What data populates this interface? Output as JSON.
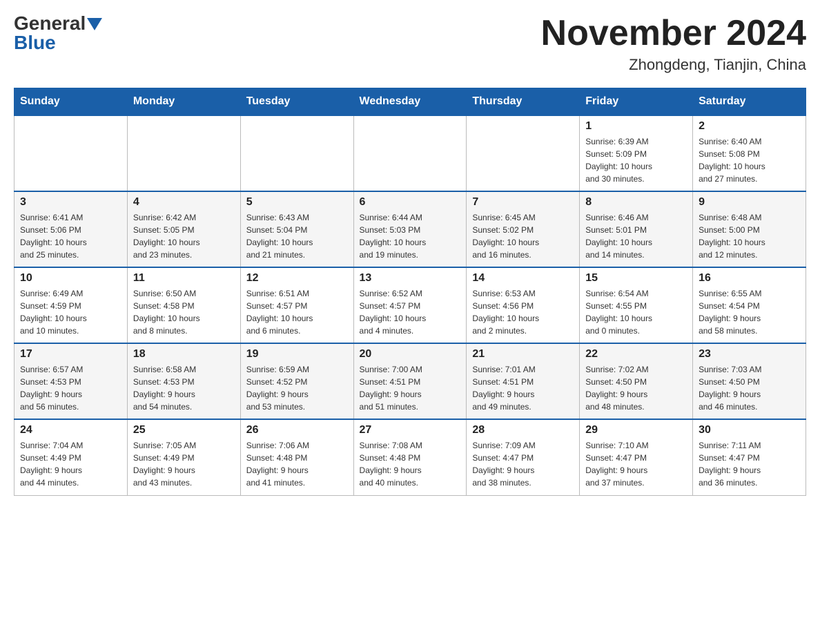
{
  "header": {
    "logo": {
      "general": "General",
      "blue": "Blue"
    },
    "title": "November 2024",
    "location": "Zhongdeng, Tianjin, China"
  },
  "weekdays": [
    "Sunday",
    "Monday",
    "Tuesday",
    "Wednesday",
    "Thursday",
    "Friday",
    "Saturday"
  ],
  "weeks": [
    [
      {
        "day": "",
        "info": ""
      },
      {
        "day": "",
        "info": ""
      },
      {
        "day": "",
        "info": ""
      },
      {
        "day": "",
        "info": ""
      },
      {
        "day": "",
        "info": ""
      },
      {
        "day": "1",
        "info": "Sunrise: 6:39 AM\nSunset: 5:09 PM\nDaylight: 10 hours\nand 30 minutes."
      },
      {
        "day": "2",
        "info": "Sunrise: 6:40 AM\nSunset: 5:08 PM\nDaylight: 10 hours\nand 27 minutes."
      }
    ],
    [
      {
        "day": "3",
        "info": "Sunrise: 6:41 AM\nSunset: 5:06 PM\nDaylight: 10 hours\nand 25 minutes."
      },
      {
        "day": "4",
        "info": "Sunrise: 6:42 AM\nSunset: 5:05 PM\nDaylight: 10 hours\nand 23 minutes."
      },
      {
        "day": "5",
        "info": "Sunrise: 6:43 AM\nSunset: 5:04 PM\nDaylight: 10 hours\nand 21 minutes."
      },
      {
        "day": "6",
        "info": "Sunrise: 6:44 AM\nSunset: 5:03 PM\nDaylight: 10 hours\nand 19 minutes."
      },
      {
        "day": "7",
        "info": "Sunrise: 6:45 AM\nSunset: 5:02 PM\nDaylight: 10 hours\nand 16 minutes."
      },
      {
        "day": "8",
        "info": "Sunrise: 6:46 AM\nSunset: 5:01 PM\nDaylight: 10 hours\nand 14 minutes."
      },
      {
        "day": "9",
        "info": "Sunrise: 6:48 AM\nSunset: 5:00 PM\nDaylight: 10 hours\nand 12 minutes."
      }
    ],
    [
      {
        "day": "10",
        "info": "Sunrise: 6:49 AM\nSunset: 4:59 PM\nDaylight: 10 hours\nand 10 minutes."
      },
      {
        "day": "11",
        "info": "Sunrise: 6:50 AM\nSunset: 4:58 PM\nDaylight: 10 hours\nand 8 minutes."
      },
      {
        "day": "12",
        "info": "Sunrise: 6:51 AM\nSunset: 4:57 PM\nDaylight: 10 hours\nand 6 minutes."
      },
      {
        "day": "13",
        "info": "Sunrise: 6:52 AM\nSunset: 4:57 PM\nDaylight: 10 hours\nand 4 minutes."
      },
      {
        "day": "14",
        "info": "Sunrise: 6:53 AM\nSunset: 4:56 PM\nDaylight: 10 hours\nand 2 minutes."
      },
      {
        "day": "15",
        "info": "Sunrise: 6:54 AM\nSunset: 4:55 PM\nDaylight: 10 hours\nand 0 minutes."
      },
      {
        "day": "16",
        "info": "Sunrise: 6:55 AM\nSunset: 4:54 PM\nDaylight: 9 hours\nand 58 minutes."
      }
    ],
    [
      {
        "day": "17",
        "info": "Sunrise: 6:57 AM\nSunset: 4:53 PM\nDaylight: 9 hours\nand 56 minutes."
      },
      {
        "day": "18",
        "info": "Sunrise: 6:58 AM\nSunset: 4:53 PM\nDaylight: 9 hours\nand 54 minutes."
      },
      {
        "day": "19",
        "info": "Sunrise: 6:59 AM\nSunset: 4:52 PM\nDaylight: 9 hours\nand 53 minutes."
      },
      {
        "day": "20",
        "info": "Sunrise: 7:00 AM\nSunset: 4:51 PM\nDaylight: 9 hours\nand 51 minutes."
      },
      {
        "day": "21",
        "info": "Sunrise: 7:01 AM\nSunset: 4:51 PM\nDaylight: 9 hours\nand 49 minutes."
      },
      {
        "day": "22",
        "info": "Sunrise: 7:02 AM\nSunset: 4:50 PM\nDaylight: 9 hours\nand 48 minutes."
      },
      {
        "day": "23",
        "info": "Sunrise: 7:03 AM\nSunset: 4:50 PM\nDaylight: 9 hours\nand 46 minutes."
      }
    ],
    [
      {
        "day": "24",
        "info": "Sunrise: 7:04 AM\nSunset: 4:49 PM\nDaylight: 9 hours\nand 44 minutes."
      },
      {
        "day": "25",
        "info": "Sunrise: 7:05 AM\nSunset: 4:49 PM\nDaylight: 9 hours\nand 43 minutes."
      },
      {
        "day": "26",
        "info": "Sunrise: 7:06 AM\nSunset: 4:48 PM\nDaylight: 9 hours\nand 41 minutes."
      },
      {
        "day": "27",
        "info": "Sunrise: 7:08 AM\nSunset: 4:48 PM\nDaylight: 9 hours\nand 40 minutes."
      },
      {
        "day": "28",
        "info": "Sunrise: 7:09 AM\nSunset: 4:47 PM\nDaylight: 9 hours\nand 38 minutes."
      },
      {
        "day": "29",
        "info": "Sunrise: 7:10 AM\nSunset: 4:47 PM\nDaylight: 9 hours\nand 37 minutes."
      },
      {
        "day": "30",
        "info": "Sunrise: 7:11 AM\nSunset: 4:47 PM\nDaylight: 9 hours\nand 36 minutes."
      }
    ]
  ]
}
